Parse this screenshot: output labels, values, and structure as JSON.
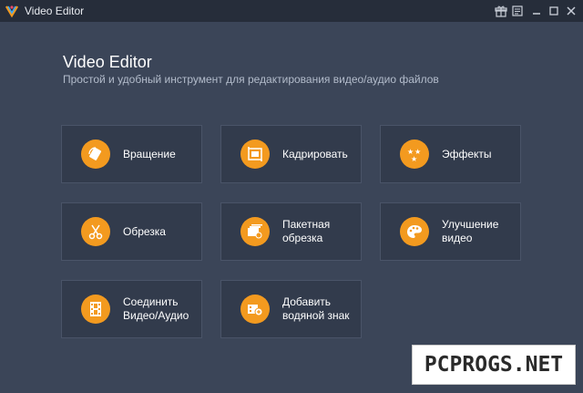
{
  "window": {
    "title": "Video Editor"
  },
  "header": {
    "title": "Video Editor",
    "subtitle": "Простой и удобный инструмент для редактирования видео/аудио файлов"
  },
  "tools": [
    {
      "label": "Вращение",
      "icon": "rotate-icon"
    },
    {
      "label": "Кадрировать",
      "icon": "crop-icon"
    },
    {
      "label": "Эффекты",
      "icon": "effects-stars-icon"
    },
    {
      "label": "Обрезка",
      "icon": "scissors-icon"
    },
    {
      "label": "Пакетная обрезка",
      "icon": "batch-trim-icon"
    },
    {
      "label": "Улучшение видео",
      "icon": "palette-enhance-icon"
    },
    {
      "label": "Соединить Видео/Аудио",
      "icon": "film-join-icon"
    },
    {
      "label": "Добавить водяной знак",
      "icon": "watermark-icon"
    }
  ],
  "watermark": {
    "text": "PCPROGS.NET"
  },
  "colors": {
    "background": "#3b4558",
    "card": "#323b4c",
    "accent": "#f39a1f",
    "titlebar": "#262d3a"
  }
}
